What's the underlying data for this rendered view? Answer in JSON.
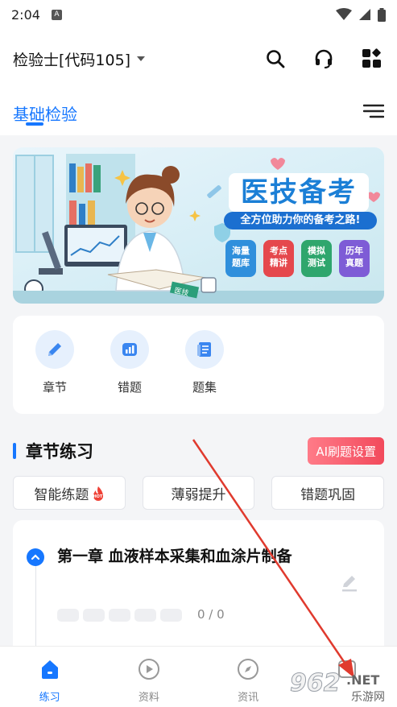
{
  "status_bar": {
    "time": "2:04",
    "notification_icon": "A"
  },
  "header": {
    "subject": "检验士[代码105]",
    "icons": [
      "search-icon",
      "headset-icon",
      "apps-icon"
    ]
  },
  "tabs": {
    "active": "基础检验"
  },
  "banner": {
    "title": "医技备考",
    "subtitle": "全方位助力你的备考之路!",
    "features": [
      {
        "line1": "海量",
        "line2": "题库"
      },
      {
        "line1": "考点",
        "line2": "精讲"
      },
      {
        "line1": "模拟",
        "line2": "测试"
      },
      {
        "line1": "历年",
        "line2": "真题"
      }
    ],
    "book_text": "医技",
    "colors": {
      "title": "#1b7fd6",
      "accent_red": "#e53945"
    }
  },
  "quick_actions": [
    {
      "label": "章节",
      "icon": "pencil-icon"
    },
    {
      "label": "错题",
      "icon": "chart-icon"
    },
    {
      "label": "题集",
      "icon": "document-icon"
    }
  ],
  "section": {
    "title": "章节练习",
    "ai_button": "AI刷题设置"
  },
  "chips": [
    {
      "label": "智能练题",
      "badge": "HOT"
    },
    {
      "label": "薄弱提升"
    },
    {
      "label": "错题巩固"
    }
  ],
  "chapter": {
    "title": "第一章 血液样本采集和血涂片制备",
    "progress": "0 / 0"
  },
  "bottom_nav": [
    {
      "label": "练习",
      "icon": "home-icon",
      "active": true
    },
    {
      "label": "资料",
      "icon": "play-icon",
      "active": false
    },
    {
      "label": "资讯",
      "icon": "compass-icon",
      "active": false
    },
    {
      "label": "",
      "icon": "profile-icon",
      "active": false
    }
  ],
  "watermark": {
    "brand": "962",
    "suffix": ".NET",
    "tagline": "乐游网"
  },
  "colors": {
    "accent": "#1677ff",
    "ai_button": "#f24a5c"
  }
}
